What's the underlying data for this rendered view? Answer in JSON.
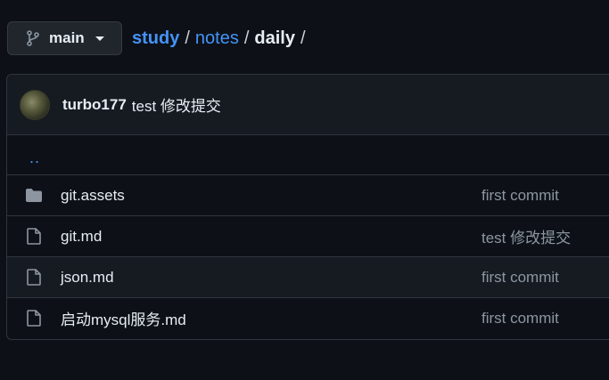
{
  "branch": {
    "name": "main",
    "icon": "git-branch-icon"
  },
  "breadcrumb": {
    "items": [
      "study",
      "notes"
    ],
    "separator": "/",
    "current": "daily",
    "trailing": "/"
  },
  "commit": {
    "author": "turbo177",
    "message": "test 修改提交"
  },
  "up_link": "..",
  "files": [
    {
      "type": "folder",
      "name": "git.assets",
      "message": "first commit"
    },
    {
      "type": "file",
      "name": "git.md",
      "message": "test 修改提交"
    },
    {
      "type": "file",
      "name": "json.md",
      "message": "first commit"
    },
    {
      "type": "file",
      "name": "启动mysql服务.md",
      "message": "first commit"
    }
  ],
  "colors": {
    "background": "#0d1117",
    "link": "#4493f8",
    "muted": "#8d96a0",
    "border": "#30363d"
  }
}
